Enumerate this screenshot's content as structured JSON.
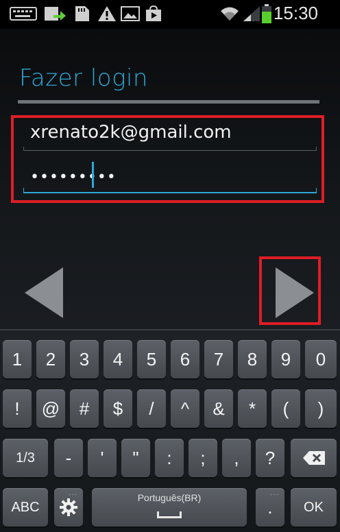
{
  "status_bar": {
    "time": "15:30",
    "icons": [
      "keyboard-icon",
      "upload-icon",
      "sd-card-icon",
      "warning-icon",
      "gallery-icon",
      "play-store-icon",
      "wifi-icon",
      "signal-icon",
      "battery-icon"
    ]
  },
  "login": {
    "title": "Fazer login",
    "email_value": "xrenato2k@gmail.com",
    "password_mask": "•••••••••"
  },
  "keyboard": {
    "row1": [
      "1",
      "2",
      "3",
      "4",
      "5",
      "6",
      "7",
      "8",
      "9",
      "0"
    ],
    "row2": [
      "!",
      "@",
      "#",
      "$",
      "/",
      "^",
      "&",
      "*",
      "(",
      ")"
    ],
    "row3": [
      "1/3",
      "-",
      "'",
      "\"",
      ":",
      ";",
      ",",
      "?"
    ],
    "abc_label": "ABC",
    "space_label": "Português(BR)",
    "period_label": ".",
    "ok_label": "OK"
  },
  "colors": {
    "accent": "#2fa8d8",
    "highlight": "#e01d25"
  }
}
